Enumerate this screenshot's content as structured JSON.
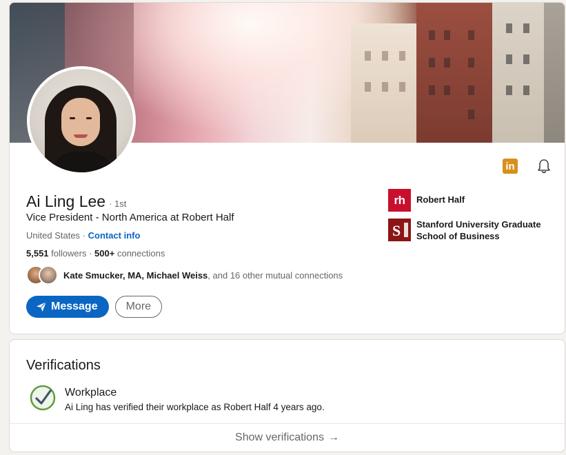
{
  "profile": {
    "name": "Ai Ling Lee",
    "degree": "· 1st",
    "headline": "Vice President - North America at Robert Half",
    "location": "United States ·",
    "contact_info": "Contact info",
    "followers_count": "5,551",
    "followers_label": "followers ·",
    "connections_count": "500+",
    "connections_label": "connections",
    "mutual_names": "Kate Smucker, MA, Michael Weiss",
    "mutual_rest": ", and 16 other mutual connections"
  },
  "actions": {
    "message_label": "Message",
    "more_label": "More"
  },
  "organizations": [
    {
      "name": "Robert Half",
      "logo_text": "rh",
      "logo_color": "#c8102e"
    },
    {
      "name": "Stanford University Graduate School of Business",
      "logo_text": "S",
      "logo_color": "#8c1515"
    }
  ],
  "top_icons": [
    "linkedin-icon",
    "bell-icon"
  ],
  "verifications": {
    "title": "Verifications",
    "item_title": "Workplace",
    "item_desc": "Ai Ling has verified their workplace as Robert Half 4 years ago.",
    "show_label": "Show verifications",
    "show_arrow": "→"
  },
  "colors": {
    "primary": "#0a66c2",
    "linkedin_premium": "#d7901c",
    "verify_green": "#5f9b41"
  }
}
